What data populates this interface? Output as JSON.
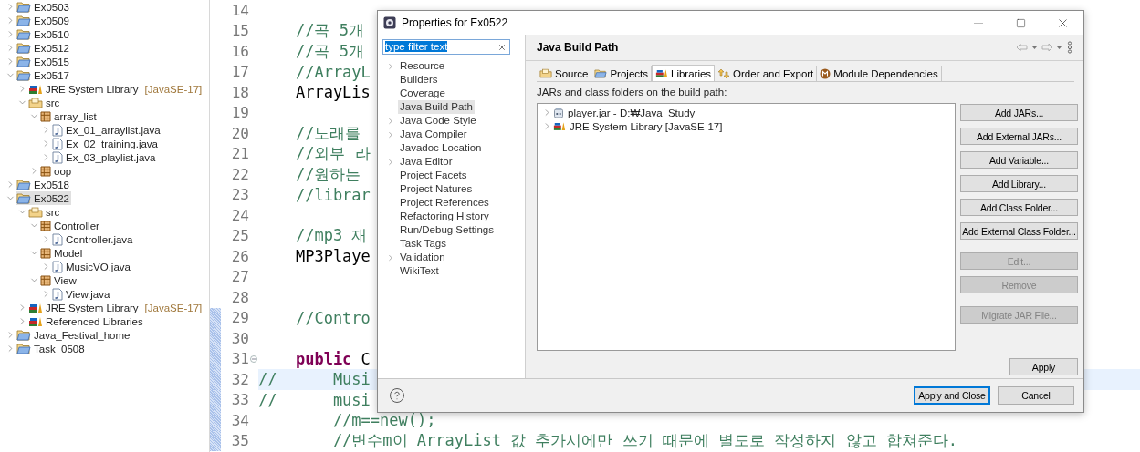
{
  "explorer": {
    "items": [
      {
        "label": "Ex0503",
        "kind": "project",
        "expanded": false,
        "selected": false
      },
      {
        "label": "Ex0509",
        "kind": "project",
        "expanded": false,
        "selected": false
      },
      {
        "label": "Ex0510",
        "kind": "project",
        "expanded": false,
        "selected": false
      },
      {
        "label": "Ex0512",
        "kind": "project",
        "expanded": false,
        "selected": false
      },
      {
        "label": "Ex0515",
        "kind": "project",
        "expanded": false,
        "selected": false
      },
      {
        "label": "Ex0517",
        "kind": "project",
        "expanded": true,
        "selected": false,
        "children": [
          {
            "label": "JRE System Library",
            "decoration": "[JavaSE-17]",
            "kind": "library",
            "expanded": false,
            "selected": false
          },
          {
            "label": "src",
            "kind": "source",
            "expanded": true,
            "selected": false,
            "children": [
              {
                "label": "array_list",
                "kind": "package",
                "expanded": true,
                "selected": false,
                "children": [
                  {
                    "label": "Ex_01_arraylist.java",
                    "kind": "java",
                    "expanded": false,
                    "selected": false
                  },
                  {
                    "label": "Ex_02_training.java",
                    "kind": "java",
                    "expanded": false,
                    "selected": false
                  },
                  {
                    "label": "Ex_03_playlist.java",
                    "kind": "java",
                    "expanded": false,
                    "selected": false
                  }
                ]
              },
              {
                "label": "oop",
                "kind": "package",
                "expanded": false,
                "selected": false
              }
            ]
          }
        ]
      },
      {
        "label": "Ex0518",
        "kind": "project",
        "expanded": false,
        "selected": false
      },
      {
        "label": "Ex0522",
        "kind": "project",
        "expanded": true,
        "selected": true,
        "children": [
          {
            "label": "src",
            "kind": "source",
            "expanded": true,
            "selected": false,
            "children": [
              {
                "label": "Controller",
                "kind": "package",
                "expanded": true,
                "selected": false,
                "children": [
                  {
                    "label": "Controller.java",
                    "kind": "java",
                    "expanded": false,
                    "selected": false
                  }
                ]
              },
              {
                "label": "Model",
                "kind": "package",
                "expanded": true,
                "selected": false,
                "children": [
                  {
                    "label": "MusicVO.java",
                    "kind": "java",
                    "expanded": false,
                    "selected": false
                  }
                ]
              },
              {
                "label": "View",
                "kind": "package",
                "expanded": true,
                "selected": false,
                "children": [
                  {
                    "label": "View.java",
                    "kind": "java",
                    "expanded": false,
                    "selected": false
                  }
                ]
              }
            ]
          },
          {
            "label": "JRE System Library",
            "decoration": "[JavaSE-17]",
            "kind": "library",
            "expanded": false,
            "selected": false
          },
          {
            "label": "Referenced Libraries",
            "kind": "library",
            "expanded": false,
            "selected": false
          }
        ]
      },
      {
        "label": "Java_Festival_home",
        "kind": "project",
        "expanded": false,
        "selected": false
      },
      {
        "label": "Task_0508",
        "kind": "project",
        "expanded": false,
        "selected": false
      }
    ]
  },
  "editor": {
    "lines": [
      {
        "number": "14",
        "changed": false,
        "current": false
      },
      {
        "number": "15",
        "changed": false,
        "current": false,
        "segments": [
          {
            "text": "    //곡 5개",
            "kind": "comment"
          }
        ]
      },
      {
        "number": "16",
        "changed": false,
        "current": false,
        "segments": [
          {
            "text": "    //곡 5개",
            "kind": "comment"
          }
        ]
      },
      {
        "number": "17",
        "changed": false,
        "current": false,
        "segments": [
          {
            "text": "    //ArrayL",
            "kind": "comment"
          }
        ]
      },
      {
        "number": "18",
        "changed": false,
        "current": false,
        "segments": [
          {
            "text": "    ArrayLis",
            "kind": "code"
          }
        ]
      },
      {
        "number": "19",
        "changed": false,
        "current": false
      },
      {
        "number": "20",
        "changed": false,
        "current": false,
        "segments": [
          {
            "text": "    //노래를",
            "kind": "comment"
          }
        ]
      },
      {
        "number": "21",
        "changed": false,
        "current": false,
        "segments": [
          {
            "text": "    //외부 라",
            "kind": "comment"
          }
        ]
      },
      {
        "number": "22",
        "changed": false,
        "current": false,
        "segments": [
          {
            "text": "    //원하는",
            "kind": "comment"
          }
        ]
      },
      {
        "number": "23",
        "changed": false,
        "current": false,
        "segments": [
          {
            "text": "    //librar",
            "kind": "comment"
          }
        ]
      },
      {
        "number": "24",
        "changed": false,
        "current": false
      },
      {
        "number": "25",
        "changed": false,
        "current": false,
        "segments": [
          {
            "text": "    //mp3 재",
            "kind": "comment"
          }
        ]
      },
      {
        "number": "26",
        "changed": false,
        "current": false,
        "segments": [
          {
            "text": "    MP3Playe",
            "kind": "code"
          }
        ]
      },
      {
        "number": "27",
        "changed": false,
        "current": false
      },
      {
        "number": "28",
        "changed": false,
        "current": false
      },
      {
        "number": "29",
        "changed": true,
        "current": false,
        "segments": [
          {
            "text": "    //Contro",
            "kind": "comment"
          }
        ]
      },
      {
        "number": "30",
        "changed": true,
        "current": false
      },
      {
        "number": "31",
        "changed": true,
        "current": false,
        "folded": true,
        "segments": [
          {
            "text": "    public",
            "kind": "keyword"
          },
          {
            "text": " C",
            "kind": "code"
          }
        ]
      },
      {
        "number": "32",
        "changed": true,
        "current": true,
        "segments": [
          {
            "text": "//      Musi",
            "kind": "comment"
          }
        ]
      },
      {
        "number": "33",
        "changed": true,
        "current": false,
        "segments": [
          {
            "text": "//      musi",
            "kind": "comment"
          }
        ]
      },
      {
        "number": "34",
        "changed": true,
        "current": false,
        "segments": [
          {
            "text": "        //m==new();",
            "kind": "comment"
          }
        ]
      },
      {
        "number": "35",
        "changed": true,
        "current": false,
        "segments": [
          {
            "text": "        //변수m이 ArrayList 값 추가시에만 쓰기 때문에 별도로 작성하지 않고 합쳐준다.",
            "kind": "comment"
          }
        ]
      }
    ]
  },
  "dialog": {
    "title": "Properties for Ex0522",
    "filter": {
      "value": "type filter text",
      "text_selected": true
    },
    "nav_items": [
      {
        "label": "Resource",
        "has_children": true,
        "selected": false
      },
      {
        "label": "Builders",
        "has_children": false,
        "selected": false
      },
      {
        "label": "Coverage",
        "has_children": false,
        "selected": false
      },
      {
        "label": "Java Build Path",
        "has_children": false,
        "selected": true
      },
      {
        "label": "Java Code Style",
        "has_children": true,
        "selected": false
      },
      {
        "label": "Java Compiler",
        "has_children": true,
        "selected": false
      },
      {
        "label": "Javadoc Location",
        "has_children": false,
        "selected": false
      },
      {
        "label": "Java Editor",
        "has_children": true,
        "selected": false
      },
      {
        "label": "Project Facets",
        "has_children": false,
        "selected": false
      },
      {
        "label": "Project Natures",
        "has_children": false,
        "selected": false
      },
      {
        "label": "Project References",
        "has_children": false,
        "selected": false
      },
      {
        "label": "Refactoring History",
        "has_children": false,
        "selected": false
      },
      {
        "label": "Run/Debug Settings",
        "has_children": false,
        "selected": false
      },
      {
        "label": "Task Tags",
        "has_children": false,
        "selected": false
      },
      {
        "label": "Validation",
        "has_children": true,
        "selected": false
      },
      {
        "label": "WikiText",
        "has_children": false,
        "selected": false
      }
    ],
    "page_title": "Java Build Path",
    "tabs": [
      {
        "label": "Source",
        "kind": "source",
        "selected": false
      },
      {
        "label": "Projects",
        "kind": "projects",
        "selected": false
      },
      {
        "label": "Libraries",
        "kind": "libraries",
        "selected": true
      },
      {
        "label": "Order and Export",
        "kind": "order",
        "selected": false
      },
      {
        "label": "Module Dependencies",
        "kind": "modules",
        "selected": false
      }
    ],
    "list_label": "JARs and class folders on the build path:",
    "entries": [
      {
        "label": "player.jar - D:₩Java_Study",
        "kind": "jar"
      },
      {
        "label": "JRE System Library [JavaSE-17]",
        "kind": "library"
      }
    ],
    "side_button_groups": [
      [
        {
          "label": "Add JARs...",
          "disabled": false
        },
        {
          "label": "Add External JARs...",
          "disabled": false
        },
        {
          "label": "Add Variable...",
          "disabled": false
        },
        {
          "label": "Add Library...",
          "disabled": false
        },
        {
          "label": "Add Class Folder...",
          "disabled": false
        },
        {
          "label": "Add External Class Folder...",
          "disabled": false
        }
      ],
      [
        {
          "label": "Edit...",
          "disabled": true
        },
        {
          "label": "Remove",
          "disabled": true
        }
      ],
      [
        {
          "label": "Migrate JAR File...",
          "disabled": true
        }
      ]
    ],
    "apply": "Apply",
    "footer_buttons": [
      {
        "label": "Apply and Close",
        "default": true
      },
      {
        "label": "Cancel",
        "default": false
      }
    ]
  }
}
